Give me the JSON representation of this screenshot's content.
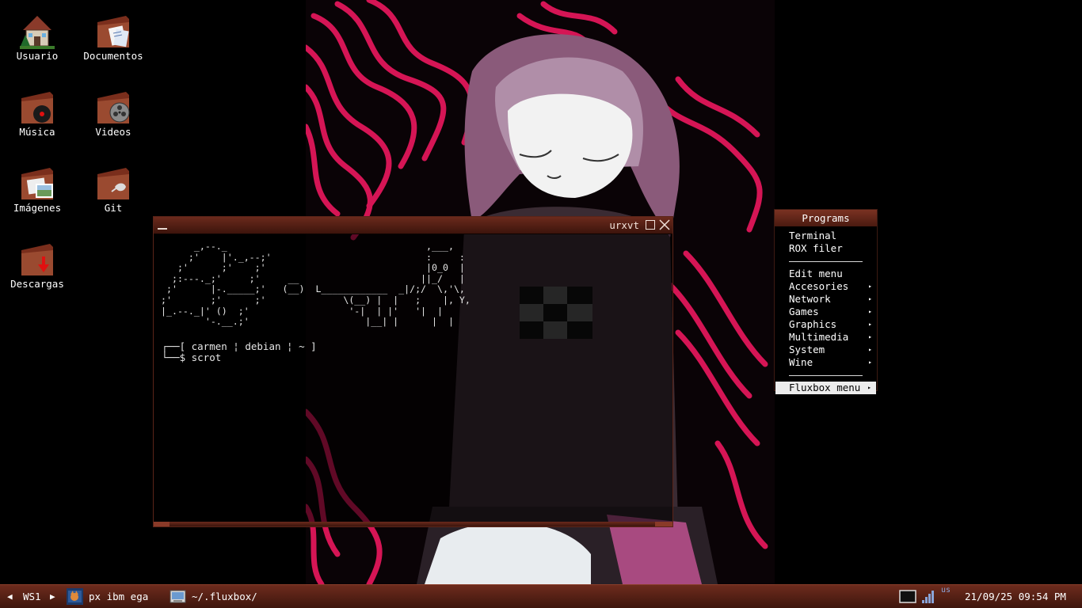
{
  "desktop": {
    "icons": [
      {
        "label": "Usuario",
        "icon": "house-icon"
      },
      {
        "label": "Documentos",
        "icon": "documents-folder-icon"
      },
      {
        "label": "Música",
        "icon": "music-folder-icon"
      },
      {
        "label": "Videos",
        "icon": "videos-folder-icon"
      },
      {
        "label": "Imágenes",
        "icon": "images-folder-icon"
      },
      {
        "label": "Git",
        "icon": "git-folder-icon"
      },
      {
        "label": "Descargas",
        "icon": "downloads-folder-icon"
      }
    ]
  },
  "terminal": {
    "title": "urxvt",
    "ascii_art": "      _,--._                                    ,___,\n     ;'    |'._,--;'                            :     :\n   ;'      ;'    ;'                             |0_0  |\n  ;:---._;'     ;'     __                      ||_/   |\n ;'      |-._____;'   (__)  L____________  _|/;/  \\,'\\,\n;'       ;'      ;'              \\(__) |  |   ;    |, Y,\n|_.--._|' ()  ;'                  '-|  | |'   '|  |\n        '-.__.;'                     |__| |      |  |",
    "prompt_line": "┌──[ carmen ¦ debian ¦ ~ ]",
    "command_line": "└──$ scrot",
    "colors": {
      "frame": "#6b2a1c",
      "frame_dark": "#3c140c"
    }
  },
  "root_menu": {
    "title": "Programs",
    "items": [
      {
        "label": "Terminal",
        "submenu": false
      },
      {
        "label": "ROX filer",
        "submenu": false
      },
      {
        "separator": true
      },
      {
        "label": "Edit menu",
        "submenu": false
      },
      {
        "label": "Accesories",
        "submenu": true
      },
      {
        "label": "Network",
        "submenu": true
      },
      {
        "label": "Games",
        "submenu": true
      },
      {
        "label": "Graphics",
        "submenu": true
      },
      {
        "label": "Multimedia",
        "submenu": true
      },
      {
        "label": "System",
        "submenu": true
      },
      {
        "label": "Wine",
        "submenu": true
      },
      {
        "separator": true
      },
      {
        "label": "Fluxbox menu",
        "submenu": true,
        "active": true
      }
    ],
    "arrow_glyph": "▸"
  },
  "taskbar": {
    "prev_ws_glyph": "◀",
    "workspace": "WS1",
    "next_ws_glyph": "▶",
    "tasks": [
      {
        "label": "px ibm ega",
        "icon": "image-viewer-icon"
      },
      {
        "label": "~/.fluxbox/",
        "icon": "file-manager-icon"
      }
    ],
    "keyboard_layout": "us",
    "clock": "21/09/25 09:54 PM",
    "colors": {
      "bar": "#6d2b1d",
      "bar_dark": "#3e160d"
    }
  },
  "colors": {
    "accent_pink": "#e0175a",
    "menu_highlight": "#ececec"
  }
}
